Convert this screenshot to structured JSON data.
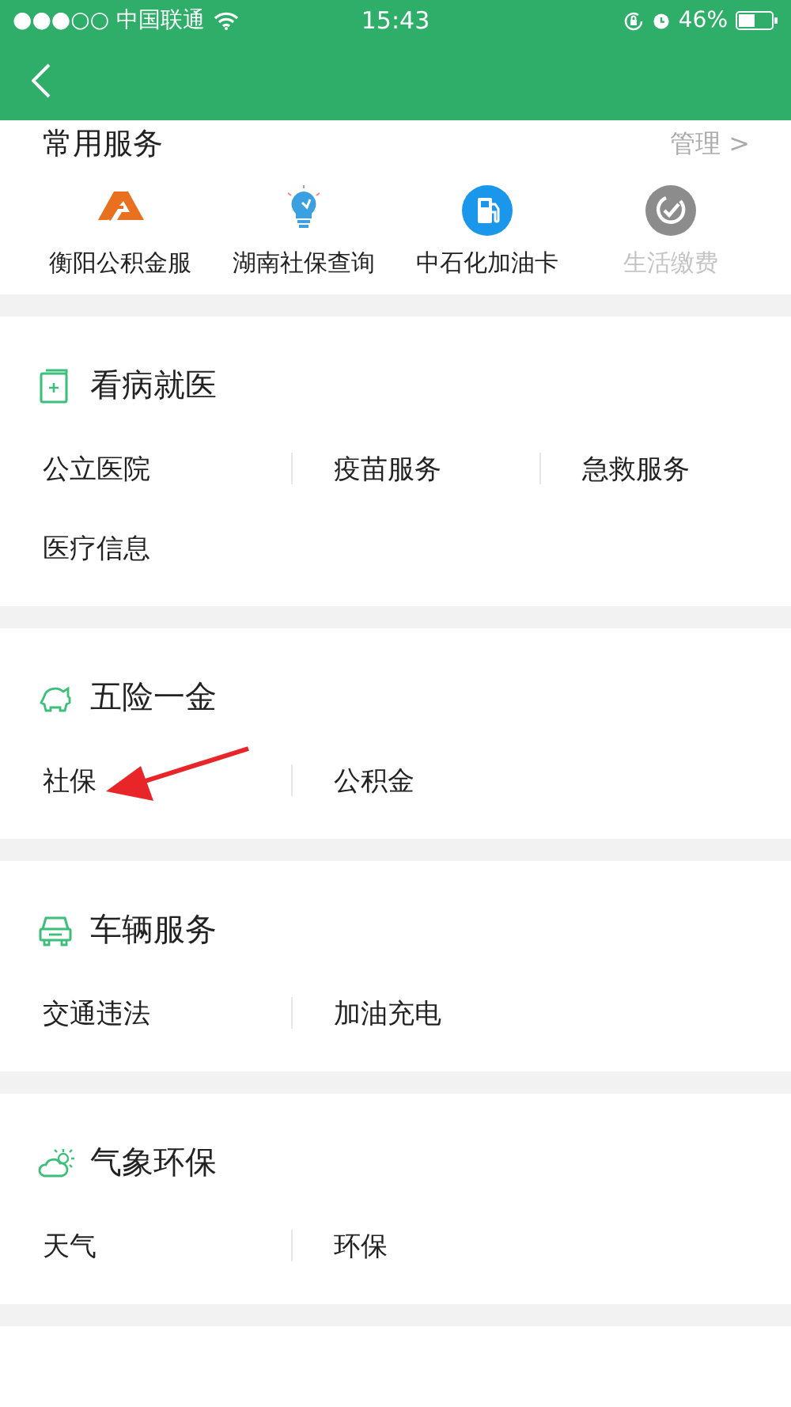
{
  "status_bar": {
    "carrier": "●●●○○ 中国联通",
    "time": "15:43",
    "battery": "46%"
  },
  "common_services": {
    "title": "常用服务",
    "manage": "管理 >",
    "items": [
      {
        "label": "衡阳公积金服",
        "disabled": false
      },
      {
        "label": "湖南社保查询",
        "disabled": false
      },
      {
        "label": "中石化加油卡",
        "disabled": false
      },
      {
        "label": "生活缴费",
        "disabled": true
      }
    ]
  },
  "sections": [
    {
      "title": "看病就医",
      "items": [
        "公立医院",
        "疫苗服务",
        "急救服务",
        "医疗信息"
      ]
    },
    {
      "title": "五险一金",
      "items": [
        "社保",
        "公积金"
      ]
    },
    {
      "title": "车辆服务",
      "items": [
        "交通违法",
        "加油充电"
      ]
    },
    {
      "title": "气象环保",
      "items": [
        "天气",
        "环保"
      ]
    }
  ]
}
